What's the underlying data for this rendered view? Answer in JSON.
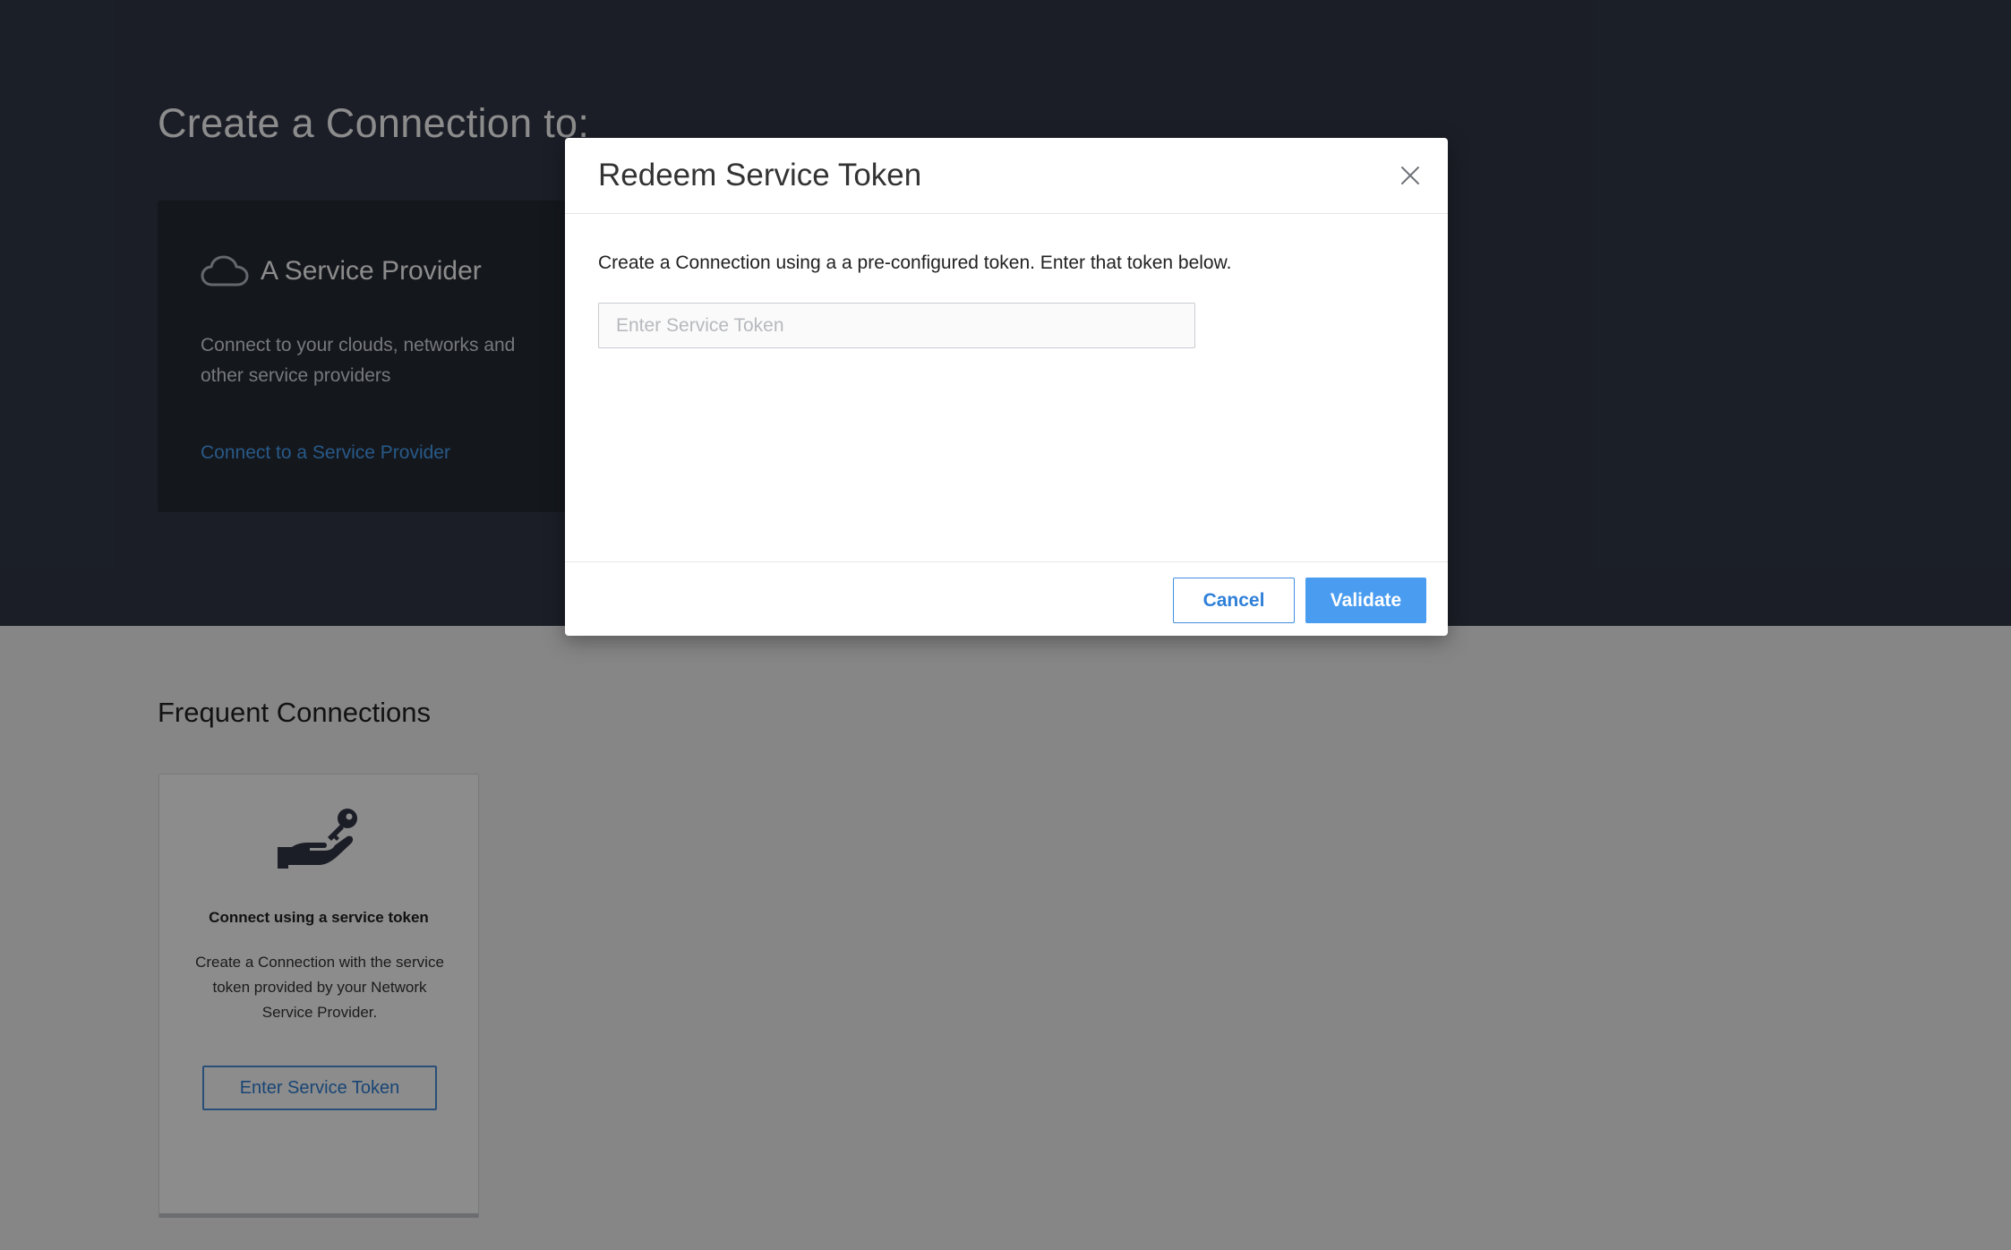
{
  "hero": {
    "title": "Create a Connection to:",
    "provider_card": {
      "icon": "cloud-icon",
      "title": "A Service Provider",
      "description": "Connect to your clouds, networks and other service providers",
      "link": "Connect to a Service Provider"
    }
  },
  "frequent": {
    "title": "Frequent Connections",
    "token_card": {
      "icon": "hand-key-icon",
      "title": "Connect using a service token",
      "description": "Create a Connection with the service token provided by your Network Service Provider.",
      "button": "Enter Service Token"
    }
  },
  "modal": {
    "title": "Redeem Service Token",
    "close_icon": "close-icon",
    "body_text": "Create a Connection using a a pre-configured token. Enter that token below.",
    "input": {
      "value": "",
      "placeholder": "Enter Service Token"
    },
    "cancel_label": "Cancel",
    "validate_label": "Validate"
  },
  "colors": {
    "hero_background": "#323847",
    "card_background": "#262a33",
    "link": "#4aa3f7",
    "primary_button": "#4a9cf0",
    "overlay": "rgba(0,0,0,0.45)"
  }
}
